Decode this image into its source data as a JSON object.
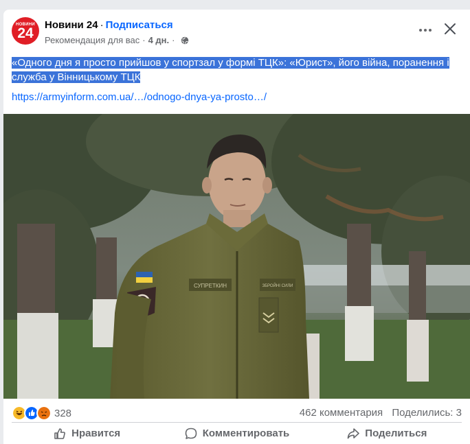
{
  "header": {
    "avatar_small": "НОВИНИ",
    "avatar_big": "24",
    "page_name": "Новини 24",
    "separator": "·",
    "subscribe_label": "Подписаться",
    "recommendation": "Рекомендация для вас",
    "time": "4 дн."
  },
  "post": {
    "text": "«Одного дня я просто прийшов у спортзал у формі ТЦК»: «Юрист», його війна, поранення і служба у Вінницькому ТЦК",
    "link": "https://armyinform.com.ua/…/odnogo-dnya-ya-prosto…/"
  },
  "photo": {
    "uniform_name_tag": "СУПРЕТКИН",
    "uniform_right_tag": "ЗБРОЙНІ СИЛИ"
  },
  "footer": {
    "reaction_count": "328",
    "comments": "462 комментария",
    "shares": "Поделились: 3",
    "like_label": "Нравится",
    "comment_label": "Комментировать",
    "share_label": "Поделиться"
  },
  "colors": {
    "accent": "#0866ff",
    "brand_red": "#e01e26",
    "highlight": "#3b73d9",
    "secondary_text": "#65676b"
  }
}
